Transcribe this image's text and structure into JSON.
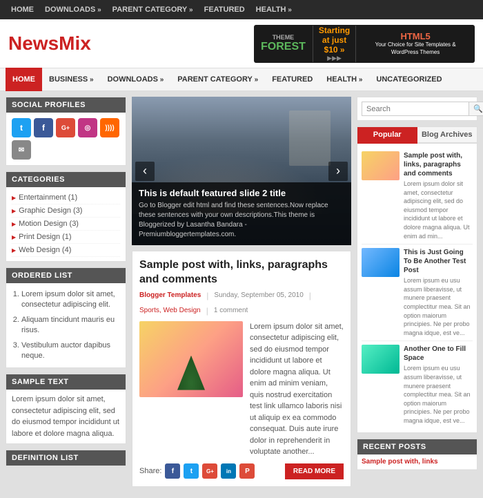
{
  "topNav": {
    "items": [
      {
        "label": "HOME",
        "arrow": false
      },
      {
        "label": "DOWNLOADS",
        "arrow": true
      },
      {
        "label": "PARENT CATEGORY",
        "arrow": true
      },
      {
        "label": "FEATURED",
        "arrow": false
      },
      {
        "label": "HEALTH",
        "arrow": true
      }
    ]
  },
  "header": {
    "logo": {
      "prefix": "News",
      "suffix": "Mix"
    },
    "banner": {
      "theme_label": "THEME",
      "forest": "FOREST",
      "starting": "Starting at just $10 »",
      "tagline": "Your Choice for Site Templates & WordPress Themes",
      "html5": "HTML5"
    }
  },
  "mainNav": {
    "items": [
      {
        "label": "HOME",
        "active": true,
        "arrow": false
      },
      {
        "label": "BUSINESS",
        "active": false,
        "arrow": true
      },
      {
        "label": "DOWNLOADS",
        "active": false,
        "arrow": true
      },
      {
        "label": "PARENT CATEGORY",
        "active": false,
        "arrow": true
      },
      {
        "label": "FEATURED",
        "active": false,
        "arrow": false
      },
      {
        "label": "HEALTH",
        "active": false,
        "arrow": true
      },
      {
        "label": "UNCATEGORIZED",
        "active": false,
        "arrow": false
      }
    ]
  },
  "sidebarLeft": {
    "socialProfiles": {
      "title": "SOCIAL PROFILES",
      "icons": [
        "T",
        "f",
        "G+",
        "📷",
        "RSS",
        "✉"
      ]
    },
    "categories": {
      "title": "CATEGORIES",
      "items": [
        {
          "label": "Entertainment (1)"
        },
        {
          "label": "Graphic Design (3)"
        },
        {
          "label": "Motion Design (3)"
        },
        {
          "label": "Print Design (1)"
        },
        {
          "label": "Web Design (4)"
        }
      ]
    },
    "orderedList": {
      "title": "ORDERED LIST",
      "items": [
        "Lorem ipsum dolor sit amet, consectetur adipiscing elit.",
        "Aliquam tincidunt mauris eu risus.",
        "Vestibulum auctor dapibus neque."
      ]
    },
    "sampleText": {
      "title": "SAMPLE TEXT",
      "content": "Lorem ipsum dolor sit amet, consectetur adipiscing elit, sed do eiusmod tempor incididunt ut labore et dolore magna aliqua."
    },
    "definitionList": {
      "title": "DEFINITION LIST"
    }
  },
  "slider": {
    "title": "This is default featured slide 2 title",
    "caption": "Go to Blogger edit html and find these sentences.Now replace these sentences with your own descriptions.This theme is Bloggerized by Lasantha Bandara - Premiumbloggertemplates.com.",
    "prevLabel": "‹",
    "nextLabel": "›"
  },
  "post": {
    "title": "Sample post with, links, paragraphs and comments",
    "meta": {
      "source": "Blogger Templates",
      "date": "Sunday, September 05, 2010",
      "tags": "Sports, Web Design",
      "comments": "1 comment"
    },
    "excerpt": "Lorem ipsum dolor sit amet, consectetur adipiscing elit, sed do eiusmod tempor incididunt ut labore et dolore magna aliqua. Ut enim ad minim veniam, quis nostrud exercitation test link ullamco laboris nisi ut aliquip ex ea commodo consequat. Duis aute irure dolor in reprehenderit in voluptate another...",
    "shareLabel": "Share:",
    "readMore": "READ MORE"
  },
  "sidebarRight": {
    "search": {
      "placeholder": "Search",
      "buttonIcon": "🔍"
    },
    "tabs": {
      "popular": "Popular",
      "blogArchives": "Blog Archives"
    },
    "popularPosts": [
      {
        "title": "Sample post with, links, paragraphs and comments",
        "excerpt": "Lorem ipsum dolor sit amet, consectetur adipiscing elit, sed do eiusmod tempor incididunt ut labore et dolore magna aliqua. Ut enim ad min...",
        "thumbClass": "pt-sunset"
      },
      {
        "title": "This is Just Going To Be Another Test Post",
        "excerpt": "Lorem ipsum eu usu assum liberavisse, ut munere praesent complectitur mea. Sit an option maiorum principies. Ne per probo magna idque, est ve...",
        "thumbClass": "pt-water"
      },
      {
        "title": "Another One to Fill Space",
        "excerpt": "Lorem ipsum eu usu assum liberavisse, ut munere praesent complectitur mea. Sit an option maiorum principies. Ne per probo magna idque, est ve...",
        "thumbClass": "pt-field"
      }
    ],
    "recentPosts": {
      "title": "RECENT POSTS",
      "items": [
        "Sample post with, links"
      ]
    }
  }
}
